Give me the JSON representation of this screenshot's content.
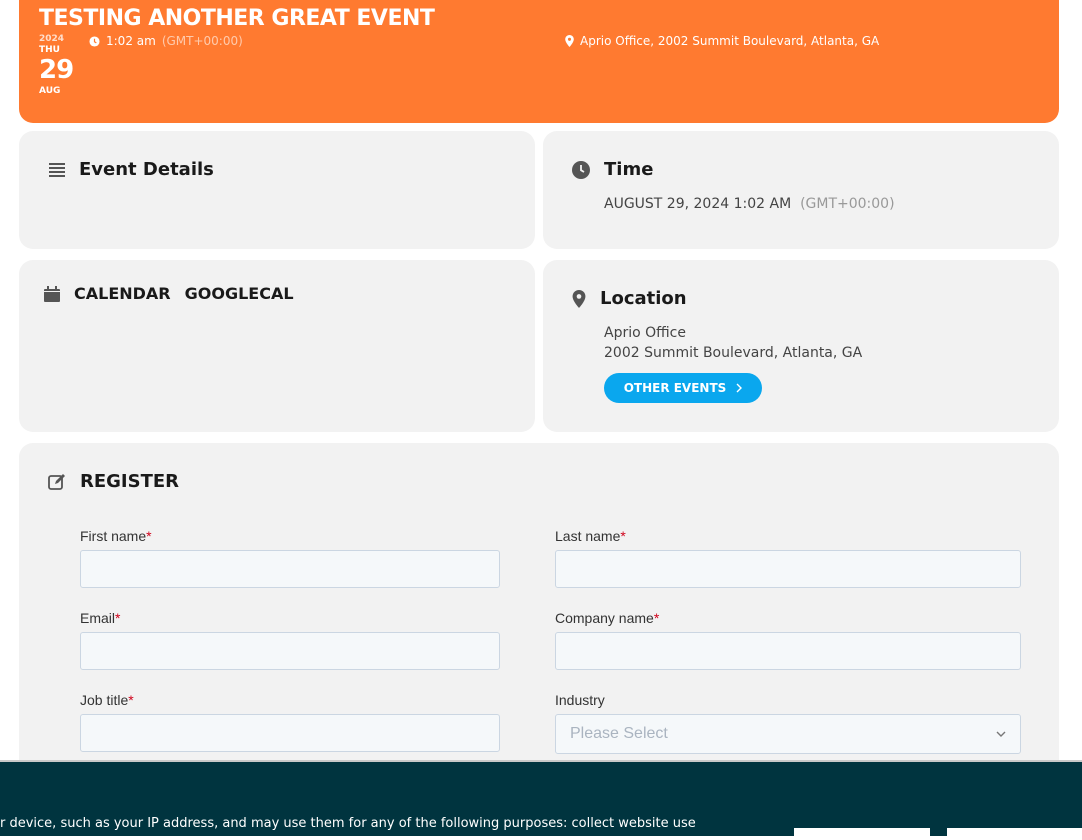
{
  "event": {
    "title": "TESTING ANOTHER GREAT EVENT",
    "year": "2024",
    "dow": "THU",
    "day": "29",
    "month": "AUG",
    "time": "1:02 am",
    "timezone": "(GMT+00:00)",
    "location_short": "Aprio Office, 2002 Summit Boulevard, Atlanta, GA"
  },
  "details": {
    "heading": "Event Details"
  },
  "time_card": {
    "heading": "Time",
    "datetime": "AUGUST 29, 2024 1:02 AM",
    "timezone": "(GMT+00:00)"
  },
  "calendar": {
    "label_1": "CALENDAR",
    "label_2": "GOOGLECAL"
  },
  "location_card": {
    "heading": "Location",
    "line1": "Aprio Office",
    "line2": "2002 Summit Boulevard, Atlanta, GA",
    "button": "OTHER EVENTS"
  },
  "register": {
    "heading": "REGISTER",
    "required_mark": "*",
    "fields": {
      "first_name": "First name",
      "last_name": "Last name",
      "email": "Email",
      "company": "Company name",
      "job_title": "Job title",
      "industry": "Industry"
    },
    "industry_placeholder": "Please Select"
  },
  "cookie": {
    "text": "r device, such as your IP address, and may use them for any of the following purposes: collect website use"
  },
  "colors": {
    "accent": "#ff7a30",
    "button": "#0aa7ee",
    "cookie_bg": "#00343f"
  }
}
